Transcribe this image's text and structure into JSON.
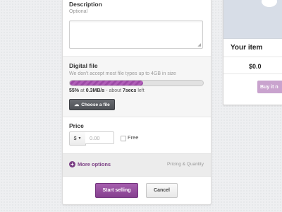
{
  "form": {
    "description": {
      "label": "Description",
      "sublabel": "Optional",
      "value": ""
    },
    "digital_file": {
      "label": "Digital file",
      "sublabel": "We don't accept most file types up to 4GB in size",
      "progress_fraction": 0.55,
      "progress": {
        "percent": "55%",
        "at": "at",
        "speed": "0.3MB/s",
        "about": "- about",
        "remaining": "7secs",
        "left": "left"
      },
      "choose_button": "Choose a file",
      "choose_icon": "cloud-upload-icon"
    },
    "price": {
      "label": "Price",
      "currency": "$",
      "placeholder": "0.00",
      "free_label": "Free",
      "free_checked": false
    },
    "more_options": {
      "label": "More options",
      "hint": "Pricing & Quantity",
      "icon": "plus-circle-icon"
    },
    "actions": {
      "start": "Start selling",
      "cancel": "Cancel"
    }
  },
  "preview": {
    "title": "Your item",
    "price": "$0.0",
    "buy_button": "Buy it n"
  },
  "colors": {
    "accent": "#8a4594",
    "accent_light": "#c9a3ce",
    "background": "#eeeff1"
  }
}
